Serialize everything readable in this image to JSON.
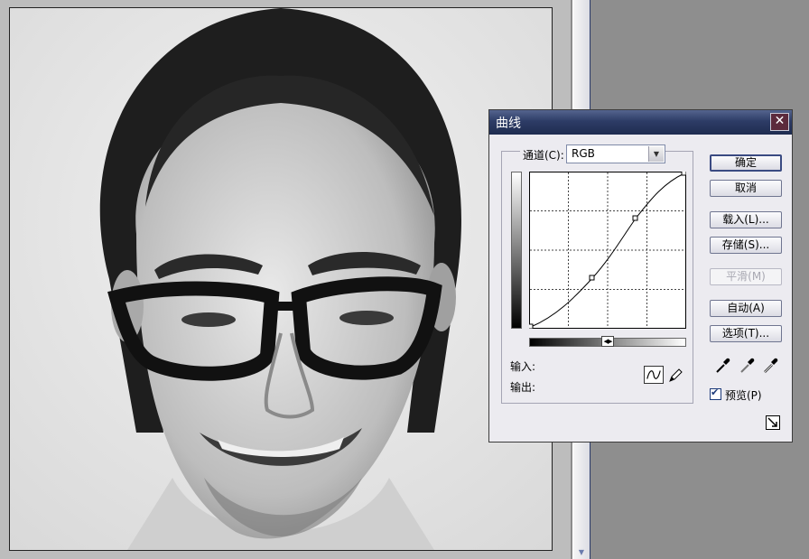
{
  "dialog": {
    "title": "曲线",
    "channel_label": "通道(C):",
    "channel_value": "RGB",
    "input_label": "输入:",
    "output_label": "输出:",
    "buttons": {
      "ok": "确定",
      "cancel": "取消",
      "load": "载入(L)...",
      "save": "存储(S)...",
      "smooth": "平滑(M)",
      "auto": "自动(A)",
      "options": "选项(T)..."
    },
    "preview_label": "预览(P)",
    "preview_checked": true,
    "curve_points": [
      [
        0,
        0
      ],
      [
        0.4,
        0.33
      ],
      [
        0.68,
        0.71
      ],
      [
        1,
        1
      ]
    ]
  },
  "icons": [
    "close-icon",
    "curve-tool-icon",
    "pencil-tool-icon",
    "black-eyedropper-icon",
    "gray-eyedropper-icon",
    "white-eyedropper-icon",
    "expand-icon"
  ]
}
